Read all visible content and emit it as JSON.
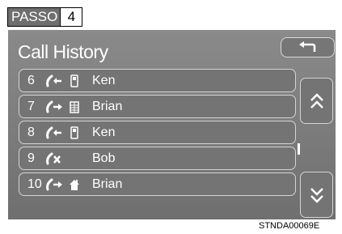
{
  "step": {
    "label": "PASSO",
    "number": "4"
  },
  "title": "Call History",
  "back_button": {
    "icon": "back-arrow-icon"
  },
  "calls": [
    {
      "index": "6",
      "direction": "incoming",
      "number_type": "mobile",
      "name": "Ken"
    },
    {
      "index": "7",
      "direction": "outgoing",
      "number_type": "office",
      "name": "Brian"
    },
    {
      "index": "8",
      "direction": "incoming",
      "number_type": "mobile",
      "name": "Ken"
    },
    {
      "index": "9",
      "direction": "missed",
      "number_type": "",
      "name": "Bob"
    },
    {
      "index": "10",
      "direction": "outgoing",
      "number_type": "home",
      "name": "Brian"
    }
  ],
  "scroll": {
    "up_icon": "double-chevron-up-icon",
    "down_icon": "double-chevron-down-icon"
  },
  "footer_code": "STNDA00069E",
  "colors": {
    "screen": "#7d7d7d",
    "border": "#d4d4d4",
    "text": "#ffffff"
  }
}
